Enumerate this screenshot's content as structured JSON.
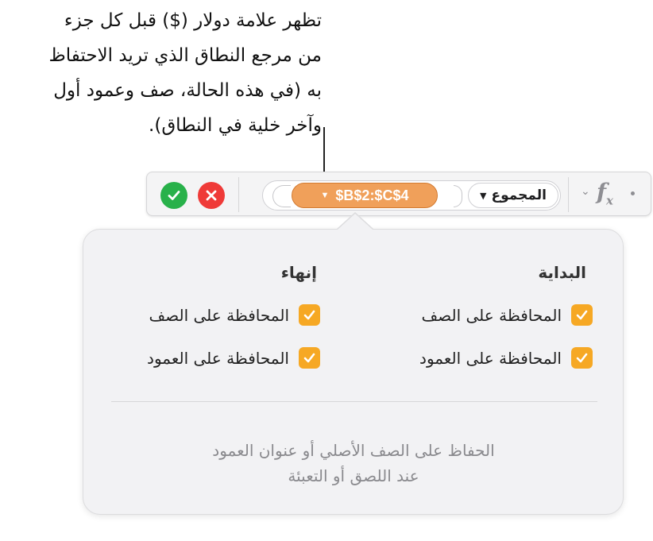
{
  "callout": {
    "lines": [
      "تظهر علامة دولار ($) قبل كل جزء",
      "من مرجع النطاق الذي تريد الاحتفاظ",
      "به (في هذه الحالة، صف وعمود أول",
      "وآخر خلية في النطاق)."
    ]
  },
  "formula_bar": {
    "range_token": "$B$2:$C$4",
    "function_token": "المجموع",
    "fx_label": "f",
    "fx_sub": "x"
  },
  "popover": {
    "start_heading": "البداية",
    "end_heading": "إنهاء",
    "start_preserve_row": "المحافظة على الصف",
    "start_preserve_column": "المحافظة على العمود",
    "end_preserve_row": "المحافظة على الصف",
    "end_preserve_column": "المحافظة على العمود",
    "preserve_note_lines": [
      "الحفاظ على الصف الأصلي أو عنوان العمود",
      "عند اللصق أو التعبئة"
    ]
  },
  "colors": {
    "accent_checkbox": "#f6a824",
    "range_token": "#f0a05a",
    "confirm": "#28b14a",
    "cancel": "#ef3a38"
  }
}
